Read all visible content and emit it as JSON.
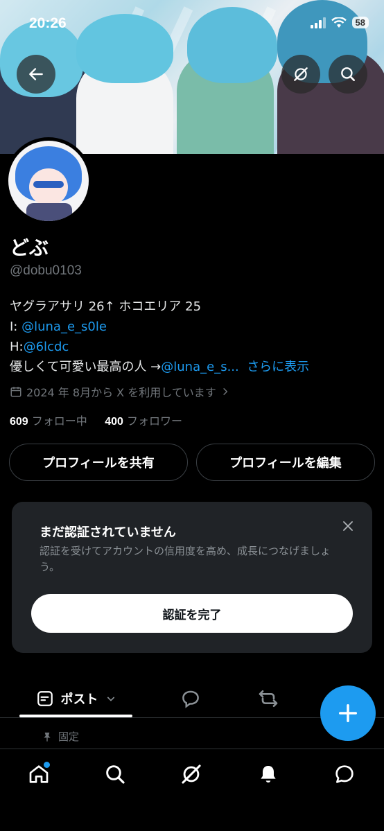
{
  "status_bar": {
    "time": "20:26",
    "battery": "58"
  },
  "profile": {
    "name": "どぶ",
    "handle": "@dobu0103",
    "bio_line1": "ヤグラアサリ 26↑ ホコエリア 25",
    "bio_line2_prefix": "I: ",
    "bio_line2_link": "@luna_e_s0le",
    "bio_line3_prefix": "H:",
    "bio_line3_link": "@6lcdc",
    "bio_line4_prefix": "優しくて可愛い最高の人 →",
    "bio_line4_link": "@luna_e_s...",
    "more_link": "さらに表示",
    "joined": "2024 年 8月から X を利用しています",
    "following_count": "609",
    "following_label": "フォロー中",
    "followers_count": "400",
    "followers_label": "フォロワー"
  },
  "actions": {
    "share_label": "プロフィールを共有",
    "edit_label": "プロフィールを編集"
  },
  "verify_card": {
    "title": "まだ認証されていません",
    "description": "認証を受けてアカウントの信用度を高め、成長につなげましょう。",
    "button_label": "認証を完了"
  },
  "tabs": {
    "posts_label": "ポスト"
  },
  "pinned_label": "固定",
  "colors": {
    "accent": "#1d9bf0",
    "background": "#000000",
    "card": "#202327"
  }
}
